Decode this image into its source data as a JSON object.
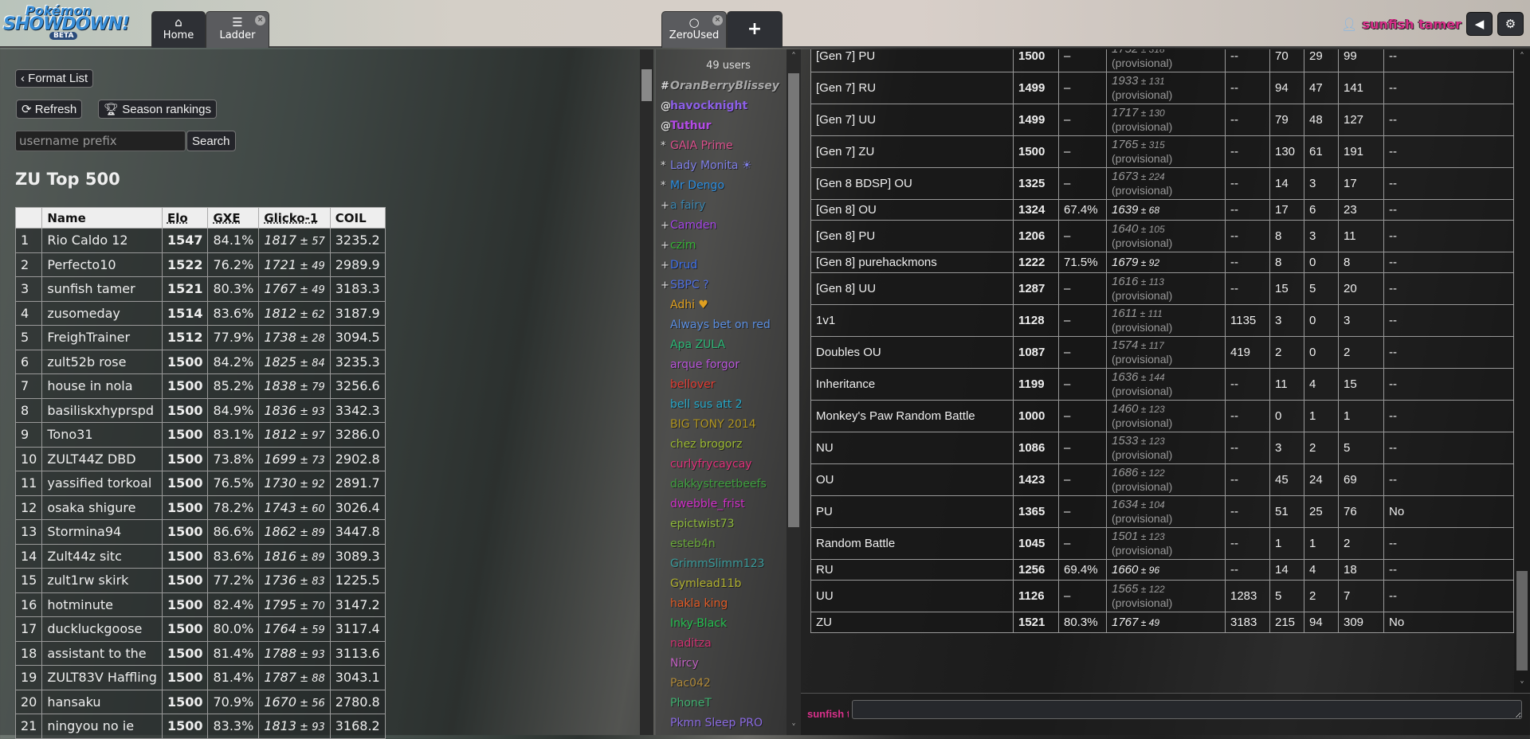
{
  "header": {
    "logo": {
      "line1": "Pokémon",
      "line2": "SHOWDOWN!",
      "badge": "BETA"
    },
    "tabs": [
      {
        "label": "Home",
        "icon": "home-icon"
      },
      {
        "label": "Ladder",
        "icon": "list-icon"
      },
      {
        "label": "ZeroUsed",
        "icon": "chat-bubble-icon"
      }
    ],
    "add_tab": "+",
    "username": "sunfish tamer",
    "sound_icon": "volume-icon",
    "settings_icon": "gear-icon",
    "colors": {
      "username": "#d8308a"
    }
  },
  "ladder": {
    "format_list": "Format List",
    "refresh": "Refresh",
    "season": "Season rankings",
    "search_placeholder": "username prefix",
    "search": "Search",
    "title": "ZU Top 500",
    "columns": [
      "",
      "Name",
      "Elo",
      "GXE",
      "Glicko-1",
      "COIL"
    ],
    "rows": [
      [
        "1",
        "Rio Caldo 12",
        "1547",
        "84.1%",
        "1817",
        "57",
        "3235.2"
      ],
      [
        "2",
        "Perfecto10",
        "1522",
        "76.2%",
        "1721",
        "49",
        "2989.9"
      ],
      [
        "3",
        "sunfish tamer",
        "1521",
        "80.3%",
        "1767",
        "49",
        "3183.3"
      ],
      [
        "4",
        "zusomeday",
        "1514",
        "83.6%",
        "1812",
        "62",
        "3187.9"
      ],
      [
        "5",
        "FreighTrainer",
        "1512",
        "77.9%",
        "1738",
        "28",
        "3094.5"
      ],
      [
        "6",
        "zult52b rose",
        "1500",
        "84.2%",
        "1825",
        "84",
        "3235.3"
      ],
      [
        "7",
        "house in nola",
        "1500",
        "85.2%",
        "1838",
        "79",
        "3256.6"
      ],
      [
        "8",
        "basiliskxhyprspd",
        "1500",
        "84.9%",
        "1836",
        "93",
        "3342.3"
      ],
      [
        "9",
        "Tono31",
        "1500",
        "83.1%",
        "1812",
        "97",
        "3286.0"
      ],
      [
        "10",
        "ZULT44Z DBD",
        "1500",
        "73.8%",
        "1699",
        "73",
        "2902.8"
      ],
      [
        "11",
        "yassified torkoal",
        "1500",
        "76.5%",
        "1730",
        "92",
        "2891.7"
      ],
      [
        "12",
        "osaka shigure",
        "1500",
        "78.2%",
        "1743",
        "60",
        "3026.4"
      ],
      [
        "13",
        "Stormina94",
        "1500",
        "86.6%",
        "1862",
        "89",
        "3447.8"
      ],
      [
        "14",
        "Zult44z sitc",
        "1500",
        "83.6%",
        "1816",
        "89",
        "3089.3"
      ],
      [
        "15",
        "zult1rw skirk",
        "1500",
        "77.2%",
        "1736",
        "83",
        "1225.5"
      ],
      [
        "16",
        "hotminute",
        "1500",
        "82.4%",
        "1795",
        "70",
        "3147.2"
      ],
      [
        "17",
        "duckluckgoose",
        "1500",
        "80.0%",
        "1764",
        "59",
        "3117.4"
      ],
      [
        "18",
        "assistant to the",
        "1500",
        "81.4%",
        "1788",
        "93",
        "3113.6"
      ],
      [
        "19",
        "ZULT83V Haffling",
        "1500",
        "81.4%",
        "1787",
        "88",
        "3043.1"
      ],
      [
        "20",
        "hansaku",
        "1500",
        "70.9%",
        "1670",
        "56",
        "2780.8"
      ],
      [
        "21",
        "ningyou no ie",
        "1500",
        "83.3%",
        "1813",
        "93",
        "3168.2"
      ]
    ]
  },
  "userlist": {
    "count": "49 users",
    "users": [
      {
        "rank": "#",
        "name": "OranBerryBlissey",
        "color": "#aaaaaa",
        "style": "b i"
      },
      {
        "rank": "@",
        "name": "havocknight",
        "color": "#8c5fe6",
        "style": "b"
      },
      {
        "rank": "@",
        "name": "Tuthur",
        "color": "#b44be6",
        "style": "b"
      },
      {
        "rank": "*",
        "name": "GAIA Prime",
        "color": "#d9508c",
        "style": ""
      },
      {
        "rank": "*",
        "name": "Lady Monita ☀",
        "color": "#7f7fe6",
        "style": ""
      },
      {
        "rank": "*",
        "name": "Mr Dengo",
        "color": "#2a8de0",
        "style": ""
      },
      {
        "rank": "+",
        "name": "a fairy",
        "color": "#3a86b0",
        "style": ""
      },
      {
        "rank": "+",
        "name": "Camden",
        "color": "#a545e6",
        "style": ""
      },
      {
        "rank": "+",
        "name": "czim",
        "color": "#35b535",
        "style": ""
      },
      {
        "rank": "+",
        "name": "Drud",
        "color": "#3d6ee8",
        "style": ""
      },
      {
        "rank": "+",
        "name": "SBPC ?",
        "color": "#4f6fe0",
        "style": ""
      },
      {
        "rank": "",
        "name": "Adhi ♥",
        "color": "#e0a020",
        "style": ""
      },
      {
        "rank": "",
        "name": "Always bet on red",
        "color": "#5b8ee0",
        "style": ""
      },
      {
        "rank": "",
        "name": "Apa ZULA",
        "color": "#2cb877",
        "style": ""
      },
      {
        "rank": "",
        "name": "arque forgor",
        "color": "#b855d9",
        "style": ""
      },
      {
        "rank": "",
        "name": "bellover",
        "color": "#e03a30",
        "style": ""
      },
      {
        "rank": "",
        "name": "bell sus att 2",
        "color": "#25a8c8",
        "style": ""
      },
      {
        "rank": "",
        "name": "BIG TONY 2014",
        "color": "#b09520",
        "style": ""
      },
      {
        "rank": "",
        "name": "chez brogorz",
        "color": "#9ab830",
        "style": ""
      },
      {
        "rank": "",
        "name": "curlyfrycaycay",
        "color": "#e0307a",
        "style": ""
      },
      {
        "rank": "",
        "name": "dakkystreetbeefs",
        "color": "#3ea03e",
        "style": ""
      },
      {
        "rank": "",
        "name": "dwebble_frist",
        "color": "#d02fc8",
        "style": ""
      },
      {
        "rank": "",
        "name": "epictwist73",
        "color": "#8db83a",
        "style": ""
      },
      {
        "rank": "",
        "name": "esteb4n",
        "color": "#6aa83a",
        "style": ""
      },
      {
        "rank": "",
        "name": "GrimmSlimm123",
        "color": "#3a9a9a",
        "style": ""
      },
      {
        "rank": "",
        "name": "Gymlead11b",
        "color": "#b0b030",
        "style": ""
      },
      {
        "rank": "",
        "name": "hakla king",
        "color": "#e05a25",
        "style": ""
      },
      {
        "rank": "",
        "name": "Inky-Black",
        "color": "#25c050",
        "style": ""
      },
      {
        "rank": "",
        "name": "naditza",
        "color": "#d03070",
        "style": ""
      },
      {
        "rank": "",
        "name": "Nircy",
        "color": "#c060c0",
        "style": ""
      },
      {
        "rank": "",
        "name": "Pac042",
        "color": "#b08a3a",
        "style": ""
      },
      {
        "rank": "",
        "name": "PhoneT",
        "color": "#40b070",
        "style": ""
      },
      {
        "rank": "",
        "name": "Pkmn Sleep PRO",
        "color": "#8a6ae0",
        "style": ""
      }
    ]
  },
  "stats": {
    "provisional_label": "(provisional)",
    "rows": [
      [
        "[Gen 7] PU",
        "1500",
        "–",
        "1752",
        "318",
        true,
        "--",
        "70",
        "29",
        "99",
        "--"
      ],
      [
        "[Gen 7] RU",
        "1499",
        "–",
        "1933",
        "131",
        true,
        "--",
        "94",
        "47",
        "141",
        "--"
      ],
      [
        "[Gen 7] UU",
        "1499",
        "–",
        "1717",
        "130",
        true,
        "--",
        "79",
        "48",
        "127",
        "--"
      ],
      [
        "[Gen 7] ZU",
        "1500",
        "–",
        "1765",
        "315",
        true,
        "--",
        "130",
        "61",
        "191",
        "--"
      ],
      [
        "[Gen 8 BDSP] OU",
        "1325",
        "–",
        "1673",
        "224",
        true,
        "--",
        "14",
        "3",
        "17",
        "--"
      ],
      [
        "[Gen 8] OU",
        "1324",
        "67.4%",
        "1639",
        "68",
        false,
        "--",
        "17",
        "6",
        "23",
        "--"
      ],
      [
        "[Gen 8] PU",
        "1206",
        "–",
        "1640",
        "105",
        true,
        "--",
        "8",
        "3",
        "11",
        "--"
      ],
      [
        "[Gen 8] purehackmons",
        "1222",
        "71.5%",
        "1679",
        "92",
        false,
        "--",
        "8",
        "0",
        "8",
        "--"
      ],
      [
        "[Gen 8] UU",
        "1287",
        "–",
        "1616",
        "113",
        true,
        "--",
        "15",
        "5",
        "20",
        "--"
      ],
      [
        "1v1",
        "1128",
        "–",
        "1611",
        "111",
        true,
        "1135",
        "3",
        "0",
        "3",
        "--"
      ],
      [
        "Doubles OU",
        "1087",
        "–",
        "1574",
        "117",
        true,
        "419",
        "2",
        "0",
        "2",
        "--"
      ],
      [
        "Inheritance",
        "1199",
        "–",
        "1636",
        "144",
        true,
        "--",
        "11",
        "4",
        "15",
        "--"
      ],
      [
        "Monkey's Paw Random Battle",
        "1000",
        "–",
        "1460",
        "123",
        true,
        "--",
        "0",
        "1",
        "1",
        "--"
      ],
      [
        "NU",
        "1086",
        "–",
        "1533",
        "123",
        true,
        "--",
        "3",
        "2",
        "5",
        "--"
      ],
      [
        "OU",
        "1423",
        "–",
        "1686",
        "122",
        true,
        "--",
        "45",
        "24",
        "69",
        "--"
      ],
      [
        "PU",
        "1365",
        "–",
        "1634",
        "104",
        true,
        "--",
        "51",
        "25",
        "76",
        "No"
      ],
      [
        "Random Battle",
        "1045",
        "–",
        "1501",
        "123",
        true,
        "--",
        "1",
        "1",
        "2",
        "--"
      ],
      [
        "RU",
        "1256",
        "69.4%",
        "1660",
        "96",
        false,
        "--",
        "14",
        "4",
        "18",
        "--"
      ],
      [
        "UU",
        "1126",
        "–",
        "1565",
        "122",
        true,
        "1283",
        "5",
        "2",
        "7",
        "--"
      ],
      [
        "ZU",
        "1521",
        "80.3%",
        "1767",
        "49",
        false,
        "3183",
        "215",
        "94",
        "309",
        "No"
      ]
    ]
  },
  "chat": {
    "username": "sunfish tamer"
  }
}
